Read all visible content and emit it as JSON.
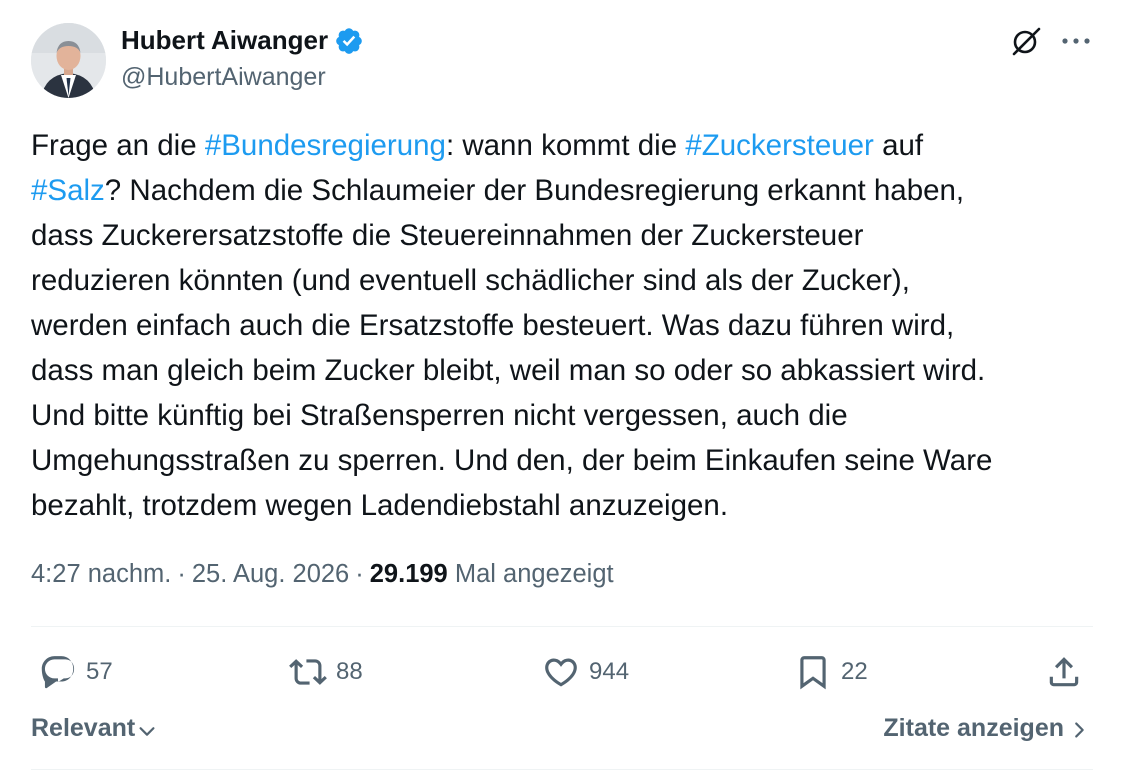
{
  "author": {
    "name": "Hubert Aiwanger",
    "handle": "@HubertAiwanger",
    "verified": true,
    "verified_color": "#1d9bf0"
  },
  "tweet": {
    "lines": [
      [
        {
          "text": "Frage an die ",
          "tag": false
        },
        {
          "text": "#Bundesregierung",
          "tag": true
        },
        {
          "text": ": wann kommt die ",
          "tag": false
        },
        {
          "text": "#Zuckersteuer",
          "tag": true
        },
        {
          "text": " auf",
          "tag": false
        }
      ],
      [
        {
          "text": "#Salz",
          "tag": true
        },
        {
          "text": "? Nachdem die Schlaumeier der Bundesregierung erkannt haben,",
          "tag": false
        }
      ],
      [
        {
          "text": "dass Zuckerersatzstoffe die Steuereinnahmen der Zuckersteuer",
          "tag": false
        }
      ],
      [
        {
          "text": "reduzieren könnten (und eventuell schädlicher sind als der Zucker),",
          "tag": false
        }
      ],
      [
        {
          "text": "werden einfach auch die Ersatzstoffe besteuert. Was dazu führen wird,",
          "tag": false
        }
      ],
      [
        {
          "text": "dass man gleich beim Zucker bleibt, weil man so oder so abkassiert wird.",
          "tag": false
        }
      ],
      [
        {
          "text": "Und bitte künftig bei Straßensperren nicht vergessen, auch die",
          "tag": false
        }
      ],
      [
        {
          "text": "Umgehungsstraßen zu sperren. Und den, der beim Einkaufen seine Ware",
          "tag": false
        }
      ],
      [
        {
          "text": "bezahlt, trotzdem wegen Ladendiebstahl anzuzeigen.",
          "tag": false
        }
      ]
    ],
    "hashtag_color": "#1d9bf0"
  },
  "meta": {
    "time": "4:27 nachm.",
    "separator": "·",
    "date": "25. Aug. 2026",
    "views": "29.199",
    "views_label": "Mal angezeigt"
  },
  "actions": {
    "replies": "57",
    "reposts": "88",
    "likes": "944",
    "bookmarks": "22"
  },
  "footer": {
    "sort_label": "Relevant",
    "quotes_label": "Zitate anzeigen"
  },
  "icons": {
    "header": [
      "grok-icon",
      "more-icon",
      "verified-badge-icon"
    ],
    "actions": [
      "reply-icon",
      "repost-icon",
      "like-icon",
      "bookmark-icon",
      "share-icon"
    ],
    "footer": [
      "chevron-down-icon",
      "chevron-right-icon"
    ]
  },
  "colors": {
    "text": "#0f1419",
    "secondary": "#536471",
    "divider": "#eff3f4"
  }
}
